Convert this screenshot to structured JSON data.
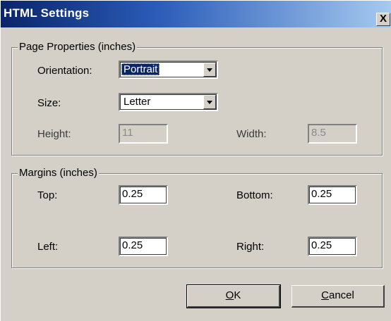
{
  "window": {
    "title": "HTML Settings",
    "close_label": "X"
  },
  "page_properties": {
    "legend": "Page Properties (inches)",
    "orientation_label": "Orientation:",
    "orientation_value": "Portrait",
    "size_label": "Size:",
    "size_value": "Letter",
    "height_label": "Height:",
    "height_value": "11",
    "width_label": "Width:",
    "width_value": "8.5"
  },
  "margins": {
    "legend": "Margins (inches)",
    "top_label": "Top:",
    "top_value": "0.25",
    "bottom_label": "Bottom:",
    "bottom_value": "0.25",
    "left_label": "Left:",
    "left_value": "0.25",
    "right_label": "Right:",
    "right_value": "0.25"
  },
  "buttons": {
    "ok_mnemonic": "O",
    "ok_rest": "K",
    "cancel_mnemonic": "C",
    "cancel_rest": "ancel"
  }
}
